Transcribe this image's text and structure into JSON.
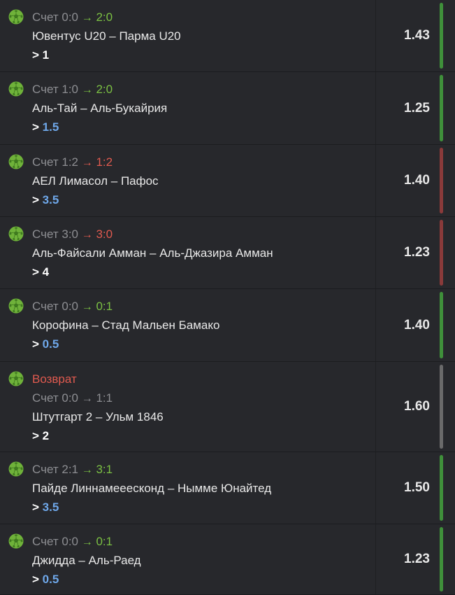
{
  "colors": {
    "win": "#3f8f3a",
    "loss": "#8a3a3a",
    "refund": "#6a6a6a"
  },
  "bets": [
    {
      "score_label": "Счет",
      "score_from": "0:0",
      "arrow": "→",
      "score_to": "2:0",
      "score_to_color": "green",
      "teams": "Ювентус U20 – Парма U20",
      "bet_symbol": ">",
      "bet_value": "1",
      "bet_value_style": "white",
      "odds": "1.43",
      "status": "win",
      "icon": "soccer-ball-icon"
    },
    {
      "score_label": "Счет",
      "score_from": "1:0",
      "arrow": "→",
      "score_to": "2:0",
      "score_to_color": "green",
      "teams": "Аль-Тай – Аль-Букайрия",
      "bet_symbol": ">",
      "bet_value": "1.5",
      "bet_value_style": "blue",
      "odds": "1.25",
      "status": "win",
      "icon": "soccer-ball-icon"
    },
    {
      "score_label": "Счет",
      "score_from": "1:2",
      "arrow": "→",
      "score_to": "1:2",
      "score_to_color": "red",
      "teams": "АЕЛ Лимасол – Пафос",
      "bet_symbol": ">",
      "bet_value": "3.5",
      "bet_value_style": "blue",
      "odds": "1.40",
      "status": "loss",
      "icon": "soccer-ball-icon"
    },
    {
      "score_label": "Счет",
      "score_from": "3:0",
      "arrow": "→",
      "score_to": "3:0",
      "score_to_color": "red",
      "teams": "Аль-Файсали Амман – Аль-Джазира Амман",
      "bet_symbol": ">",
      "bet_value": "4",
      "bet_value_style": "white",
      "odds": "1.23",
      "status": "loss",
      "icon": "soccer-ball-icon"
    },
    {
      "score_label": "Счет",
      "score_from": "0:0",
      "arrow": "→",
      "score_to": "0:1",
      "score_to_color": "green",
      "teams": "Корофина – Стад Мальен Бамако",
      "bet_symbol": ">",
      "bet_value": "0.5",
      "bet_value_style": "blue",
      "odds": "1.40",
      "status": "win",
      "icon": "soccer-ball-icon"
    },
    {
      "refund_label": "Возврат",
      "score_label": "Счет",
      "score_from": "0:0",
      "arrow": "→",
      "score_to": "1:1",
      "score_to_color": "grey",
      "teams": "Штутгарт 2 – Ульм 1846",
      "bet_symbol": ">",
      "bet_value": "2",
      "bet_value_style": "white",
      "odds": "1.60",
      "status": "refund",
      "icon": "soccer-ball-icon"
    },
    {
      "score_label": "Счет",
      "score_from": "2:1",
      "arrow": "→",
      "score_to": "3:1",
      "score_to_color": "green",
      "teams": "Пайде Линнамееесконд – Нымме Юнайтед",
      "bet_symbol": ">",
      "bet_value": "3.5",
      "bet_value_style": "blue",
      "odds": "1.50",
      "status": "win",
      "icon": "soccer-ball-icon"
    },
    {
      "score_label": "Счет",
      "score_from": "0:0",
      "arrow": "→",
      "score_to": "0:1",
      "score_to_color": "green",
      "teams": "Джидда – Аль-Раед",
      "bet_symbol": ">",
      "bet_value": "0.5",
      "bet_value_style": "blue",
      "odds": "1.23",
      "status": "win",
      "icon": "soccer-ball-icon"
    }
  ]
}
